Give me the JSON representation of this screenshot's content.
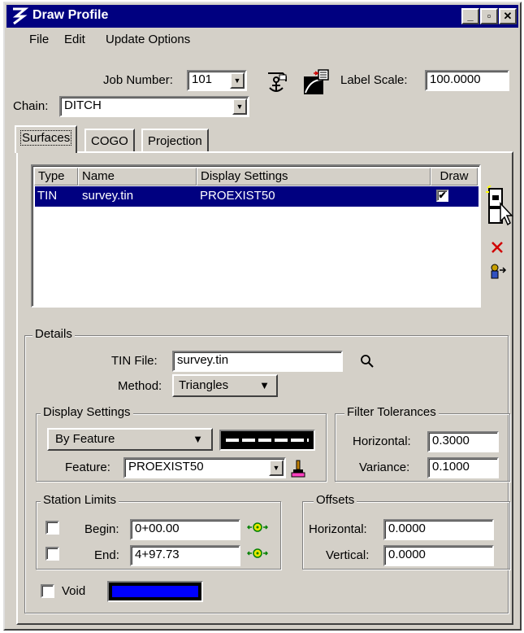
{
  "window": {
    "title": "Draw Profile"
  },
  "menu": [
    "File",
    "Edit",
    "Update Options"
  ],
  "job": {
    "label": "Job Number:",
    "value": "101"
  },
  "label_scale": {
    "label": "Label Scale:",
    "value": "100.0000"
  },
  "chain": {
    "label": "Chain:",
    "value": "DITCH"
  },
  "tabs": [
    "Surfaces",
    "COGO",
    "Projection"
  ],
  "surfaces": {
    "columns": [
      "Type",
      "Name",
      "Display Settings",
      "Draw"
    ],
    "rows": [
      {
        "type": "TIN",
        "name": "survey.tin",
        "display": "PROEXIST50",
        "draw": "✔"
      }
    ]
  },
  "details": {
    "title": "Details",
    "tin_file_label": "TIN File:",
    "tin_file_value": "survey.tin",
    "method_label": "Method:",
    "method_value": "Triangles"
  },
  "display_settings": {
    "title": "Display Settings",
    "mode": "By Feature",
    "feature_label": "Feature:",
    "feature_value": "PROEXIST50"
  },
  "filter": {
    "title": "Filter Tolerances",
    "horizontal_label": "Horizontal:",
    "horizontal_value": "0.3000",
    "variance_label": "Variance:",
    "variance_value": "0.1000"
  },
  "station": {
    "title": "Station Limits",
    "begin_label": "Begin:",
    "begin_value": "0+00.00",
    "end_label": "End:",
    "end_value": "4+97.73"
  },
  "offsets": {
    "title": "Offsets",
    "horizontal_label": "Horizontal:",
    "horizontal_value": "0.0000",
    "vertical_label": "Vertical:",
    "vertical_value": "0.0000"
  },
  "void": {
    "label": "Void",
    "color": "#0000ff"
  },
  "colors": {
    "titlebar": "#000080",
    "face": "#d4d0c8",
    "selection": "#000080"
  }
}
